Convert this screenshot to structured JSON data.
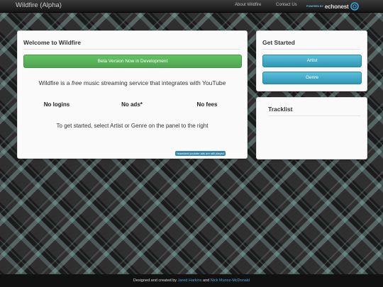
{
  "navbar": {
    "brand": "Wildfire (Alpha)",
    "about": "About Wildfire",
    "contact": "Contact Us",
    "powered_by": "POWERED BY",
    "echonest": "echonest"
  },
  "welcome": {
    "title": "Welcome to Wildfire",
    "beta": "Beta Version Now in Development",
    "lead_prefix": "Wildfire is a ",
    "lead_em": "free",
    "lead_suffix": " music streaming service that integrates with YouTube",
    "features": [
      "No logins",
      "No ads*",
      "No fees"
    ],
    "cta": "To get started, select Artist or Genre on the panel to the right",
    "footnote": "*standard youtube ads are still played"
  },
  "get_started": {
    "title": "Get Started",
    "artist": "Artist",
    "genre": "Genre"
  },
  "tracklist": {
    "title": "Tracklist"
  },
  "footer": {
    "prefix": "Designed and created by ",
    "author1": "Jared Harkins",
    "and": " and ",
    "author2": "Nick Munoz-McDonald"
  },
  "colors": {
    "success": "#5bb75b",
    "info": "#49afcd",
    "link": "#4fa3d8"
  }
}
